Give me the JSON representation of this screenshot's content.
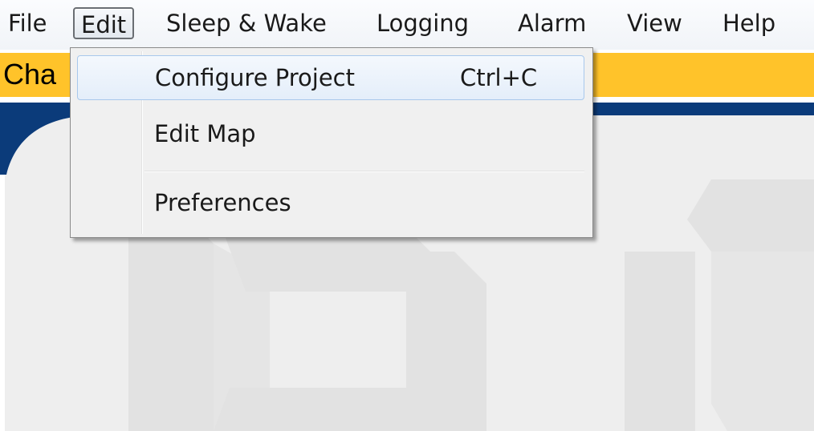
{
  "menubar": {
    "items": [
      {
        "label": "File"
      },
      {
        "label": "Edit",
        "active": true
      },
      {
        "label": "Sleep & Wake"
      },
      {
        "label": "Logging"
      },
      {
        "label": "Alarm"
      },
      {
        "label": "View"
      },
      {
        "label": "Help"
      }
    ]
  },
  "header": {
    "title_partial": "Cha"
  },
  "edit_menu": {
    "items": [
      {
        "label": "Configure Project",
        "shortcut": "Ctrl+C",
        "highlighted": true
      },
      {
        "label": "Edit Map",
        "shortcut": ""
      },
      {
        "label": "Preferences",
        "shortcut": ""
      }
    ]
  },
  "colors": {
    "title_band": "#ffc32a",
    "blue_band": "#0b3b7a",
    "menu_highlight": "#e4eefa",
    "content_bg": "#eeeeee"
  }
}
